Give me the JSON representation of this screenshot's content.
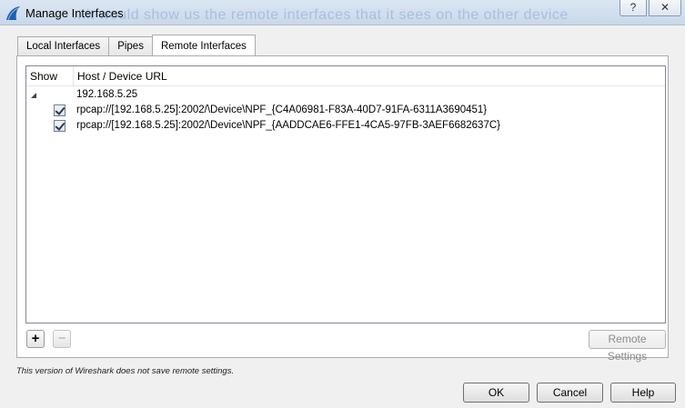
{
  "window": {
    "title": "Manage Interfaces",
    "ghost_text": "...it would show us the remote interfaces that it sees on the other device",
    "help_label": "?",
    "close_label": "✕"
  },
  "tabs": [
    {
      "label": "Local Interfaces",
      "active": false
    },
    {
      "label": "Pipes",
      "active": false
    },
    {
      "label": "Remote Interfaces",
      "active": true
    }
  ],
  "tree": {
    "columns": [
      "Show",
      "Host / Device URL"
    ],
    "host": "192.168.5.25",
    "devices": [
      {
        "url": "rpcap://[192.168.5.25]:2002/\\Device\\NPF_{C4A06981-F83A-40D7-91FA-6311A3690451}",
        "checked": true
      },
      {
        "url": "rpcap://[192.168.5.25]:2002/\\Device\\NPF_{AADDCAE6-FFE1-4CA5-97FB-3AEF6682637C}",
        "checked": true
      }
    ]
  },
  "tools": {
    "add_label": "+",
    "remove_label": "−"
  },
  "remote_settings_label": "Remote Settings",
  "note": "This version of Wireshark does not save remote settings.",
  "buttons": {
    "ok": "OK",
    "cancel": "Cancel",
    "help": "Help"
  },
  "colors": {
    "titlebar": "#c9d8ea",
    "app_icon": "#1f5fae"
  }
}
